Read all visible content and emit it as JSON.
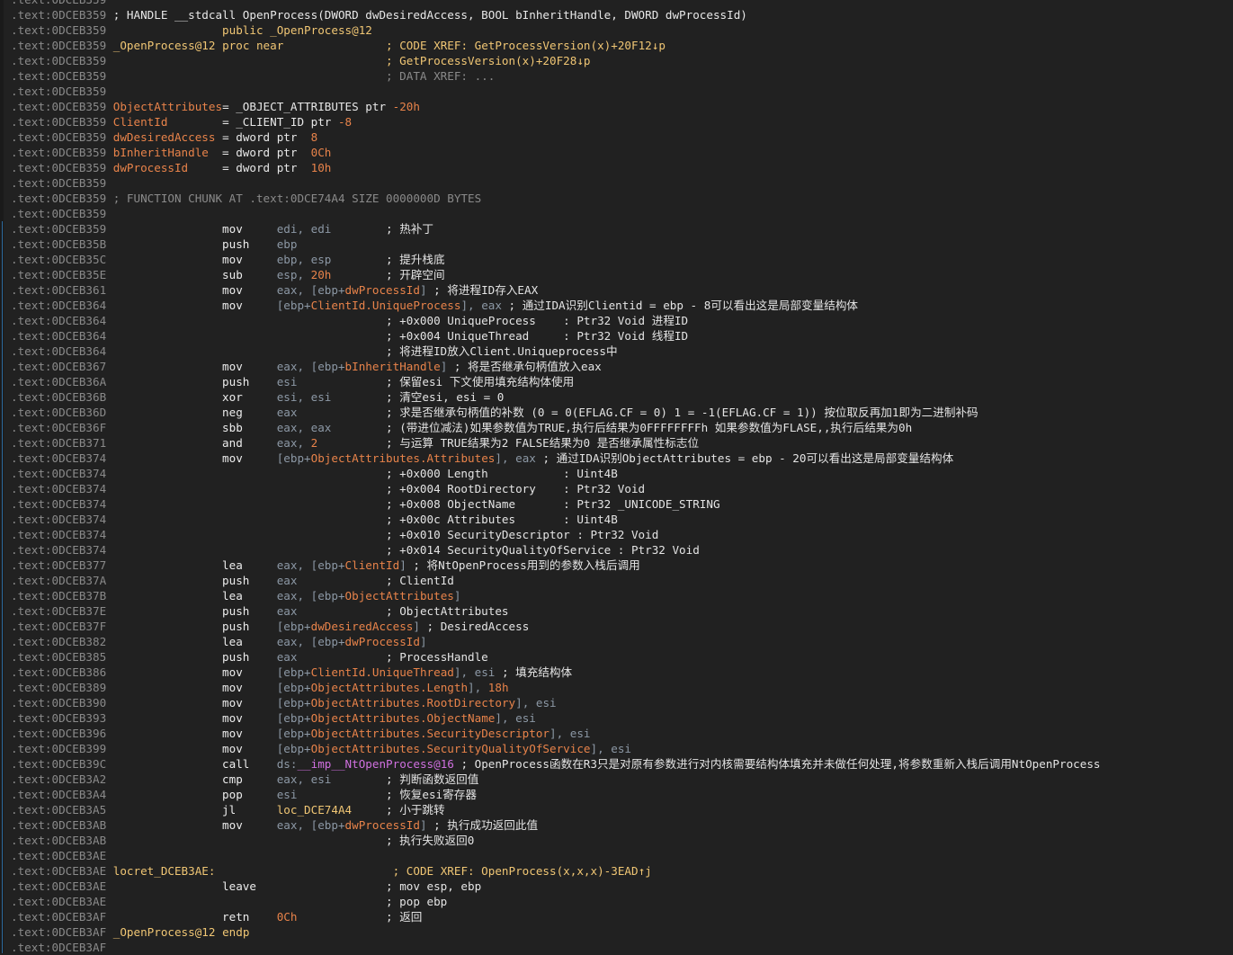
{
  "view": "IDA disassembly listing",
  "colors": {
    "background": "#212121",
    "address": "#8a8a8a",
    "label": "#f0c674",
    "stack_var": "#e8834a",
    "register": "#8c98a5",
    "comment": "#e4e4e4",
    "import": "#d070e0"
  },
  "lines": [
    {
      "addr": ".text:0DCEB359",
      "segs": []
    },
    {
      "addr": ".text:0DCEB359",
      "segs": [
        {
          "t": " ; HANDLE __stdcall OpenProcess(DWORD dwDesiredAccess, BOOL bInheritHandle, DWORD dwProcessId)",
          "c": "text"
        }
      ]
    },
    {
      "addr": ".text:0DCEB359",
      "segs": [
        {
          "t": "                 public ",
          "c": "kw"
        },
        {
          "t": "_OpenProcess@12",
          "c": "label"
        }
      ]
    },
    {
      "addr": ".text:0DCEB359",
      "segs": [
        {
          "t": " _OpenProcess@12",
          "c": "label"
        },
        {
          "t": " proc near",
          "c": "kw"
        },
        {
          "t": "               ; CODE XREF: GetProcessVersion(x)+20F12↓p",
          "c": "xref"
        }
      ]
    },
    {
      "addr": ".text:0DCEB359",
      "segs": [
        {
          "t": "                                         ; GetProcessVersion(x)+20F28↓p",
          "c": "xref"
        }
      ]
    },
    {
      "addr": ".text:0DCEB359",
      "segs": [
        {
          "t": "                                         ; DATA XREF: ...",
          "c": "gray"
        }
      ]
    },
    {
      "addr": ".text:0DCEB359",
      "segs": []
    },
    {
      "addr": ".text:0DCEB359",
      "segs": [
        {
          "t": " ObjectAttributes",
          "c": "var"
        },
        {
          "t": "= _OBJECT_ATTRIBUTES ptr ",
          "c": "text"
        },
        {
          "t": "-20h",
          "c": "num"
        }
      ]
    },
    {
      "addr": ".text:0DCEB359",
      "segs": [
        {
          "t": " ClientId",
          "c": "var"
        },
        {
          "t": "        = _CLIENT_ID ptr ",
          "c": "text"
        },
        {
          "t": "-8",
          "c": "num"
        }
      ]
    },
    {
      "addr": ".text:0DCEB359",
      "segs": [
        {
          "t": " dwDesiredAccess",
          "c": "var"
        },
        {
          "t": " = dword ptr  ",
          "c": "text"
        },
        {
          "t": "8",
          "c": "num"
        }
      ]
    },
    {
      "addr": ".text:0DCEB359",
      "segs": [
        {
          "t": " bInheritHandle",
          "c": "var"
        },
        {
          "t": "  = dword ptr  ",
          "c": "text"
        },
        {
          "t": "0Ch",
          "c": "num"
        }
      ]
    },
    {
      "addr": ".text:0DCEB359",
      "segs": [
        {
          "t": " dwProcessId",
          "c": "var"
        },
        {
          "t": "     = dword ptr  ",
          "c": "text"
        },
        {
          "t": "10h",
          "c": "num"
        }
      ]
    },
    {
      "addr": ".text:0DCEB359",
      "segs": []
    },
    {
      "addr": ".text:0DCEB359",
      "segs": [
        {
          "t": " ; FUNCTION CHUNK AT .text:0DCE74A4 SIZE 0000000D BYTES",
          "c": "gray"
        }
      ]
    },
    {
      "addr": ".text:0DCEB359",
      "segs": []
    },
    {
      "addr": ".text:0DCEB359",
      "segs": [
        {
          "t": "                 mov     ",
          "c": "ins"
        },
        {
          "t": "edi, edi",
          "c": "reg"
        },
        {
          "t": "        ; 热补丁",
          "c": "cmt"
        }
      ]
    },
    {
      "addr": ".text:0DCEB35B",
      "segs": [
        {
          "t": "                 push    ",
          "c": "ins"
        },
        {
          "t": "ebp",
          "c": "reg"
        }
      ]
    },
    {
      "addr": ".text:0DCEB35C",
      "segs": [
        {
          "t": "                 mov     ",
          "c": "ins"
        },
        {
          "t": "ebp, esp",
          "c": "reg"
        },
        {
          "t": "        ; 提升栈底",
          "c": "cmt"
        }
      ]
    },
    {
      "addr": ".text:0DCEB35E",
      "segs": [
        {
          "t": "                 sub     ",
          "c": "ins"
        },
        {
          "t": "esp, ",
          "c": "reg"
        },
        {
          "t": "20h",
          "c": "num"
        },
        {
          "t": "        ; 开辟空间",
          "c": "cmt"
        }
      ]
    },
    {
      "addr": ".text:0DCEB361",
      "segs": [
        {
          "t": "                 mov     ",
          "c": "ins"
        },
        {
          "t": "eax, [ebp+",
          "c": "reg"
        },
        {
          "t": "dwProcessId",
          "c": "field"
        },
        {
          "t": "]",
          "c": "reg"
        },
        {
          "t": " ; 将进程ID存入EAX",
          "c": "cmt"
        }
      ]
    },
    {
      "addr": ".text:0DCEB364",
      "segs": [
        {
          "t": "                 mov     ",
          "c": "ins"
        },
        {
          "t": "[ebp+",
          "c": "reg"
        },
        {
          "t": "ClientId.UniqueProcess",
          "c": "field"
        },
        {
          "t": "], eax",
          "c": "reg"
        },
        {
          "t": " ; 通过IDA识别Clientid = ebp - 8可以看出这是局部变量结构体",
          "c": "cmt"
        }
      ]
    },
    {
      "addr": ".text:0DCEB364",
      "segs": [
        {
          "t": "                                         ; +0x000 UniqueProcess    : Ptr32 Void 进程ID",
          "c": "cmt"
        }
      ]
    },
    {
      "addr": ".text:0DCEB364",
      "segs": [
        {
          "t": "                                         ; +0x004 UniqueThread     : Ptr32 Void 线程ID",
          "c": "cmt"
        }
      ]
    },
    {
      "addr": ".text:0DCEB364",
      "segs": [
        {
          "t": "                                         ; 将进程ID放入Client.Uniqueprocess中",
          "c": "cmt"
        }
      ]
    },
    {
      "addr": ".text:0DCEB367",
      "segs": [
        {
          "t": "                 mov     ",
          "c": "ins"
        },
        {
          "t": "eax, [ebp+",
          "c": "reg"
        },
        {
          "t": "bInheritHandle",
          "c": "field"
        },
        {
          "t": "]",
          "c": "reg"
        },
        {
          "t": " ; 将是否继承句柄值放入eax",
          "c": "cmt"
        }
      ]
    },
    {
      "addr": ".text:0DCEB36A",
      "segs": [
        {
          "t": "                 push    ",
          "c": "ins"
        },
        {
          "t": "esi",
          "c": "reg"
        },
        {
          "t": "             ; 保留esi 下文使用填充结构体使用",
          "c": "cmt"
        }
      ]
    },
    {
      "addr": ".text:0DCEB36B",
      "segs": [
        {
          "t": "                 xor     ",
          "c": "ins"
        },
        {
          "t": "esi, esi",
          "c": "reg"
        },
        {
          "t": "        ; 清空esi, esi = 0",
          "c": "cmt"
        }
      ]
    },
    {
      "addr": ".text:0DCEB36D",
      "segs": [
        {
          "t": "                 neg     ",
          "c": "ins"
        },
        {
          "t": "eax",
          "c": "reg"
        },
        {
          "t": "             ; 求是否继承句柄值的补数 (0 = 0(EFLAG.CF = 0) 1 = -1(EFLAG.CF = 1)) 按位取反再加1即为二进制补码",
          "c": "cmt"
        }
      ]
    },
    {
      "addr": ".text:0DCEB36F",
      "segs": [
        {
          "t": "                 sbb     ",
          "c": "ins"
        },
        {
          "t": "eax, eax",
          "c": "reg"
        },
        {
          "t": "        ; (带进位减法)如果参数值为TRUE,执行后结果为0FFFFFFFFh 如果参数值为FLASE,,执行后结果为0h",
          "c": "cmt"
        }
      ]
    },
    {
      "addr": ".text:0DCEB371",
      "segs": [
        {
          "t": "                 and     ",
          "c": "ins"
        },
        {
          "t": "eax, ",
          "c": "reg"
        },
        {
          "t": "2",
          "c": "num"
        },
        {
          "t": "          ; 与运算 TRUE结果为2 FALSE结果为0 是否继承属性标志位",
          "c": "cmt"
        }
      ]
    },
    {
      "addr": ".text:0DCEB374",
      "segs": [
        {
          "t": "                 mov     ",
          "c": "ins"
        },
        {
          "t": "[ebp+",
          "c": "reg"
        },
        {
          "t": "ObjectAttributes.Attributes",
          "c": "field"
        },
        {
          "t": "], eax",
          "c": "reg"
        },
        {
          "t": " ; 通过IDA识别ObjectAttributes = ebp - 20可以看出这是局部变量结构体",
          "c": "cmt"
        }
      ]
    },
    {
      "addr": ".text:0DCEB374",
      "segs": [
        {
          "t": "                                         ; +0x000 Length           : Uint4B",
          "c": "cmt"
        }
      ]
    },
    {
      "addr": ".text:0DCEB374",
      "segs": [
        {
          "t": "                                         ; +0x004 RootDirectory    : Ptr32 Void",
          "c": "cmt"
        }
      ]
    },
    {
      "addr": ".text:0DCEB374",
      "segs": [
        {
          "t": "                                         ; +0x008 ObjectName       : Ptr32 _UNICODE_STRING",
          "c": "cmt"
        }
      ]
    },
    {
      "addr": ".text:0DCEB374",
      "segs": [
        {
          "t": "                                         ; +0x00c Attributes       : Uint4B",
          "c": "cmt"
        }
      ]
    },
    {
      "addr": ".text:0DCEB374",
      "segs": [
        {
          "t": "                                         ; +0x010 SecurityDescriptor : Ptr32 Void",
          "c": "cmt"
        }
      ]
    },
    {
      "addr": ".text:0DCEB374",
      "segs": [
        {
          "t": "                                         ; +0x014 SecurityQualityOfService : Ptr32 Void",
          "c": "cmt"
        }
      ]
    },
    {
      "addr": ".text:0DCEB377",
      "segs": [
        {
          "t": "                 lea     ",
          "c": "ins"
        },
        {
          "t": "eax, [ebp+",
          "c": "reg"
        },
        {
          "t": "ClientId",
          "c": "field"
        },
        {
          "t": "]",
          "c": "reg"
        },
        {
          "t": " ; 将NtOpenProcess用到的参数入栈后调用",
          "c": "cmt"
        }
      ]
    },
    {
      "addr": ".text:0DCEB37A",
      "segs": [
        {
          "t": "                 push    ",
          "c": "ins"
        },
        {
          "t": "eax",
          "c": "reg"
        },
        {
          "t": "             ; ClientId",
          "c": "cmt"
        }
      ]
    },
    {
      "addr": ".text:0DCEB37B",
      "segs": [
        {
          "t": "                 lea     ",
          "c": "ins"
        },
        {
          "t": "eax, [ebp+",
          "c": "reg"
        },
        {
          "t": "ObjectAttributes",
          "c": "field"
        },
        {
          "t": "]",
          "c": "reg"
        }
      ]
    },
    {
      "addr": ".text:0DCEB37E",
      "segs": [
        {
          "t": "                 push    ",
          "c": "ins"
        },
        {
          "t": "eax",
          "c": "reg"
        },
        {
          "t": "             ; ObjectAttributes",
          "c": "cmt"
        }
      ]
    },
    {
      "addr": ".text:0DCEB37F",
      "segs": [
        {
          "t": "                 push    ",
          "c": "ins"
        },
        {
          "t": "[ebp+",
          "c": "reg"
        },
        {
          "t": "dwDesiredAccess",
          "c": "field"
        },
        {
          "t": "]",
          "c": "reg"
        },
        {
          "t": " ; DesiredAccess",
          "c": "cmt"
        }
      ]
    },
    {
      "addr": ".text:0DCEB382",
      "segs": [
        {
          "t": "                 lea     ",
          "c": "ins"
        },
        {
          "t": "eax, [ebp+",
          "c": "reg"
        },
        {
          "t": "dwProcessId",
          "c": "field"
        },
        {
          "t": "]",
          "c": "reg"
        }
      ]
    },
    {
      "addr": ".text:0DCEB385",
      "segs": [
        {
          "t": "                 push    ",
          "c": "ins"
        },
        {
          "t": "eax",
          "c": "reg"
        },
        {
          "t": "             ; ProcessHandle",
          "c": "cmt"
        }
      ]
    },
    {
      "addr": ".text:0DCEB386",
      "segs": [
        {
          "t": "                 mov     ",
          "c": "ins"
        },
        {
          "t": "[ebp+",
          "c": "reg"
        },
        {
          "t": "ClientId.UniqueThread",
          "c": "field"
        },
        {
          "t": "], esi",
          "c": "reg"
        },
        {
          "t": " ; 填充结构体",
          "c": "cmt"
        }
      ]
    },
    {
      "addr": ".text:0DCEB389",
      "segs": [
        {
          "t": "                 mov     ",
          "c": "ins"
        },
        {
          "t": "[ebp+",
          "c": "reg"
        },
        {
          "t": "ObjectAttributes.Length",
          "c": "field"
        },
        {
          "t": "], ",
          "c": "reg"
        },
        {
          "t": "18h",
          "c": "num"
        }
      ]
    },
    {
      "addr": ".text:0DCEB390",
      "segs": [
        {
          "t": "                 mov     ",
          "c": "ins"
        },
        {
          "t": "[ebp+",
          "c": "reg"
        },
        {
          "t": "ObjectAttributes.RootDirectory",
          "c": "field"
        },
        {
          "t": "], esi",
          "c": "reg"
        }
      ]
    },
    {
      "addr": ".text:0DCEB393",
      "segs": [
        {
          "t": "                 mov     ",
          "c": "ins"
        },
        {
          "t": "[ebp+",
          "c": "reg"
        },
        {
          "t": "ObjectAttributes.ObjectName",
          "c": "field"
        },
        {
          "t": "], esi",
          "c": "reg"
        }
      ]
    },
    {
      "addr": ".text:0DCEB396",
      "segs": [
        {
          "t": "                 mov     ",
          "c": "ins"
        },
        {
          "t": "[ebp+",
          "c": "reg"
        },
        {
          "t": "ObjectAttributes.SecurityDescriptor",
          "c": "field"
        },
        {
          "t": "], esi",
          "c": "reg"
        }
      ]
    },
    {
      "addr": ".text:0DCEB399",
      "segs": [
        {
          "t": "                 mov     ",
          "c": "ins"
        },
        {
          "t": "[ebp+",
          "c": "reg"
        },
        {
          "t": "ObjectAttributes.SecurityQualityOfService",
          "c": "field"
        },
        {
          "t": "], esi",
          "c": "reg"
        }
      ]
    },
    {
      "addr": ".text:0DCEB39C",
      "segs": [
        {
          "t": "                 call    ",
          "c": "ins"
        },
        {
          "t": "ds:",
          "c": "reg"
        },
        {
          "t": "__imp__NtOpenProcess@16",
          "c": "imp"
        },
        {
          "t": " ; OpenProcess函数在R3只是对原有参数进行对内核需要结构体填充并未做任何处理,将参数重新入栈后调用NtOpenProcess",
          "c": "cmt"
        }
      ]
    },
    {
      "addr": ".text:0DCEB3A2",
      "segs": [
        {
          "t": "                 cmp     ",
          "c": "ins"
        },
        {
          "t": "eax, esi",
          "c": "reg"
        },
        {
          "t": "        ; 判断函数返回值",
          "c": "cmt"
        }
      ]
    },
    {
      "addr": ".text:0DCEB3A4",
      "segs": [
        {
          "t": "                 pop     ",
          "c": "ins"
        },
        {
          "t": "esi",
          "c": "reg"
        },
        {
          "t": "             ; 恢复esi寄存器",
          "c": "cmt"
        }
      ]
    },
    {
      "addr": ".text:0DCEB3A5",
      "segs": [
        {
          "t": "                 jl      ",
          "c": "ins"
        },
        {
          "t": "loc_DCE74A4",
          "c": "label"
        },
        {
          "t": "     ; 小于跳转",
          "c": "cmt"
        }
      ]
    },
    {
      "addr": ".text:0DCEB3AB",
      "segs": [
        {
          "t": "                 mov     ",
          "c": "ins"
        },
        {
          "t": "eax, [ebp+",
          "c": "reg"
        },
        {
          "t": "dwProcessId",
          "c": "field"
        },
        {
          "t": "]",
          "c": "reg"
        },
        {
          "t": " ; 执行成功返回此值",
          "c": "cmt"
        }
      ]
    },
    {
      "addr": ".text:0DCEB3AB",
      "segs": [
        {
          "t": "                                         ; 执行失败返回0",
          "c": "cmt"
        }
      ]
    },
    {
      "addr": ".text:0DCEB3AE",
      "segs": []
    },
    {
      "addr": ".text:0DCEB3AE",
      "segs": [
        {
          "t": " locret_DCEB3AE:",
          "c": "label"
        },
        {
          "t": "                          ; CODE XREF: OpenProcess(x,x,x)-3EAD↑j",
          "c": "xref"
        }
      ]
    },
    {
      "addr": ".text:0DCEB3AE",
      "segs": [
        {
          "t": "                 leave",
          "c": "ins"
        },
        {
          "t": "                   ; mov esp, ebp",
          "c": "cmt"
        }
      ]
    },
    {
      "addr": ".text:0DCEB3AE",
      "segs": [
        {
          "t": "                                         ; pop ebp",
          "c": "cmt"
        }
      ]
    },
    {
      "addr": ".text:0DCEB3AF",
      "segs": [
        {
          "t": "                 retn    ",
          "c": "ins"
        },
        {
          "t": "0Ch",
          "c": "num"
        },
        {
          "t": "             ; 返回",
          "c": "cmt"
        }
      ]
    },
    {
      "addr": ".text:0DCEB3AF",
      "segs": [
        {
          "t": " _OpenProcess@12",
          "c": "label"
        },
        {
          "t": " endp",
          "c": "kw"
        }
      ]
    },
    {
      "addr": ".text:0DCEB3AF",
      "segs": []
    }
  ]
}
